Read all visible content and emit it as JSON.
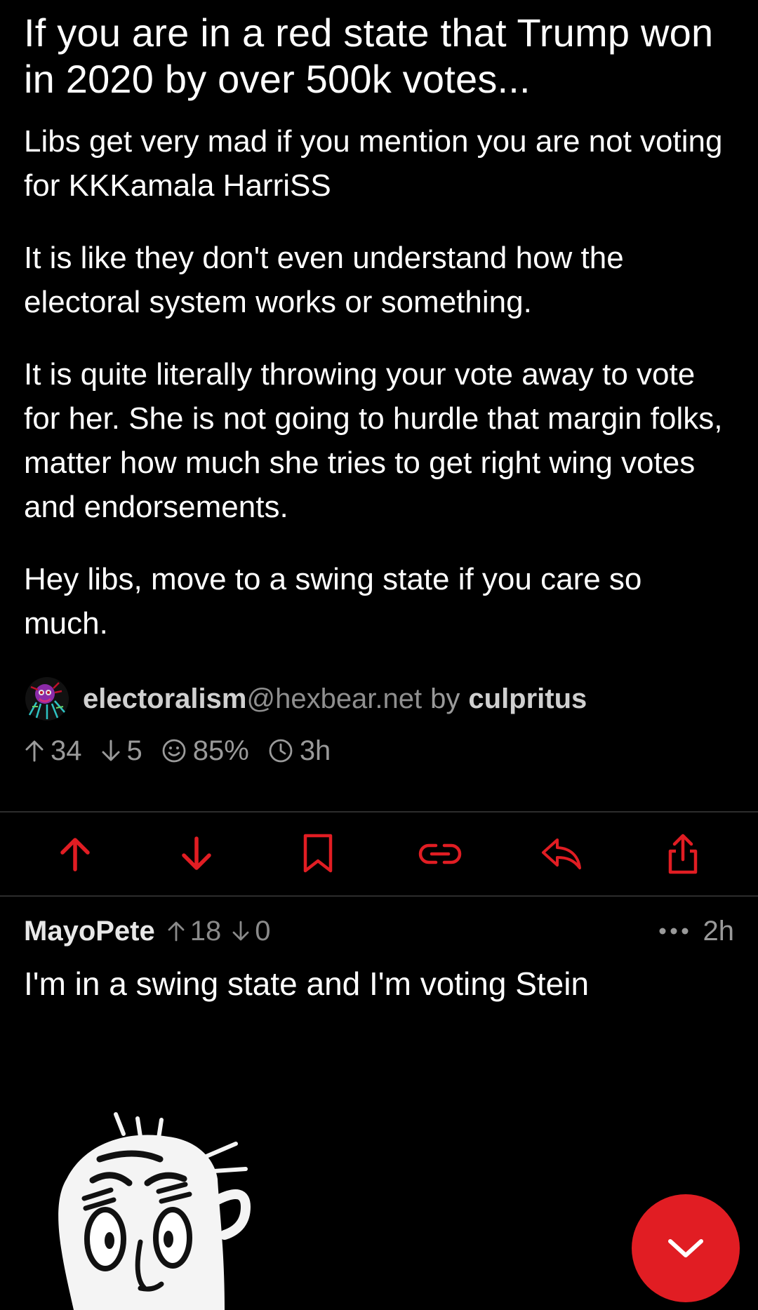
{
  "post": {
    "title": "If you are in a red state that Trump won in 2020 by over 500k votes...",
    "paragraphs": [
      "Libs get very mad if you mention you are not voting for KKKamala HarriSS",
      "It is like they don't even understand how the electoral system works or something.",
      "It is quite literally throwing your vote away to vote for her. She is not going to hurdle that margin folks, matter how much she tries to get right wing votes and endorsements.",
      "Hey libs, move to a swing state if you care so much."
    ],
    "community": {
      "name": "electoralism",
      "host": "@hexbear.net",
      "avatar_icon": "community-avatar-icon"
    },
    "by_label": "by",
    "author": "culpritus",
    "stats": {
      "upvotes": "34",
      "downvotes": "5",
      "ratio": "85%",
      "age": "3h"
    }
  },
  "actions": [
    {
      "name": "upvote",
      "icon": "arrow-up-icon"
    },
    {
      "name": "downvote",
      "icon": "arrow-down-icon"
    },
    {
      "name": "save",
      "icon": "bookmark-icon"
    },
    {
      "name": "copy-link",
      "icon": "link-icon"
    },
    {
      "name": "reply",
      "icon": "reply-icon"
    },
    {
      "name": "share",
      "icon": "share-icon"
    }
  ],
  "comment": {
    "author": "MayoPete",
    "upvotes": "18",
    "downvotes": "0",
    "age": "2h",
    "text": "I'm in a swing state and I'm voting Stein",
    "image_icon": "rage-face-image"
  },
  "colors": {
    "accent": "#e11d23",
    "background": "#000000",
    "muted_text": "#9a9a9a"
  },
  "fab_icon": "chevron-down-icon"
}
